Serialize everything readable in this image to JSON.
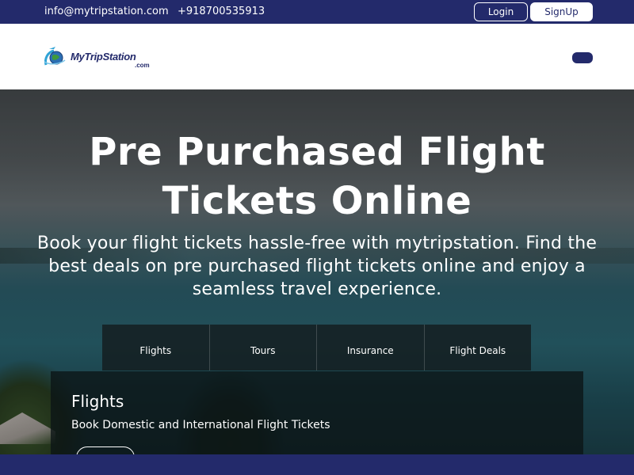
{
  "topbar": {
    "email": "info@mytripstation.com",
    "phone": "+918700535913",
    "login_label": "Login",
    "signup_label": "SignUp"
  },
  "header": {
    "logo_name": "MyTripStation",
    "logo_tld": ".com"
  },
  "hero": {
    "title": "Pre Purchased Flight Tickets Online",
    "subtitle": "Book your flight tickets hassle-free with mytripstation. Find the best deals on pre purchased flight tickets online and enjoy a seamless travel experience."
  },
  "tabs": [
    {
      "label": "Flights"
    },
    {
      "label": "Tours"
    },
    {
      "label": "Insurance"
    },
    {
      "label": "Flight Deals"
    }
  ],
  "panel": {
    "title": "Flights",
    "description": "Book Domestic and International Flight Tickets"
  },
  "colors": {
    "brand": "#232a6b",
    "white": "#ffffff"
  },
  "icons": {
    "logo": "globe-plane-icon",
    "menu": "menu-toggle-icon"
  }
}
